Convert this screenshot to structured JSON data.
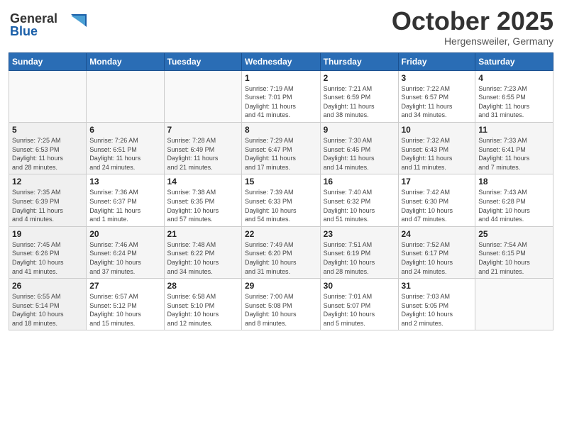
{
  "header": {
    "logo_general": "General",
    "logo_blue": "Blue",
    "month": "October 2025",
    "location": "Hergensweiler, Germany"
  },
  "weekdays": [
    "Sunday",
    "Monday",
    "Tuesday",
    "Wednesday",
    "Thursday",
    "Friday",
    "Saturday"
  ],
  "weeks": [
    [
      {
        "day": "",
        "info": ""
      },
      {
        "day": "",
        "info": ""
      },
      {
        "day": "",
        "info": ""
      },
      {
        "day": "1",
        "info": "Sunrise: 7:19 AM\nSunset: 7:01 PM\nDaylight: 11 hours\nand 41 minutes."
      },
      {
        "day": "2",
        "info": "Sunrise: 7:21 AM\nSunset: 6:59 PM\nDaylight: 11 hours\nand 38 minutes."
      },
      {
        "day": "3",
        "info": "Sunrise: 7:22 AM\nSunset: 6:57 PM\nDaylight: 11 hours\nand 34 minutes."
      },
      {
        "day": "4",
        "info": "Sunrise: 7:23 AM\nSunset: 6:55 PM\nDaylight: 11 hours\nand 31 minutes."
      }
    ],
    [
      {
        "day": "5",
        "info": "Sunrise: 7:25 AM\nSunset: 6:53 PM\nDaylight: 11 hours\nand 28 minutes."
      },
      {
        "day": "6",
        "info": "Sunrise: 7:26 AM\nSunset: 6:51 PM\nDaylight: 11 hours\nand 24 minutes."
      },
      {
        "day": "7",
        "info": "Sunrise: 7:28 AM\nSunset: 6:49 PM\nDaylight: 11 hours\nand 21 minutes."
      },
      {
        "day": "8",
        "info": "Sunrise: 7:29 AM\nSunset: 6:47 PM\nDaylight: 11 hours\nand 17 minutes."
      },
      {
        "day": "9",
        "info": "Sunrise: 7:30 AM\nSunset: 6:45 PM\nDaylight: 11 hours\nand 14 minutes."
      },
      {
        "day": "10",
        "info": "Sunrise: 7:32 AM\nSunset: 6:43 PM\nDaylight: 11 hours\nand 11 minutes."
      },
      {
        "day": "11",
        "info": "Sunrise: 7:33 AM\nSunset: 6:41 PM\nDaylight: 11 hours\nand 7 minutes."
      }
    ],
    [
      {
        "day": "12",
        "info": "Sunrise: 7:35 AM\nSunset: 6:39 PM\nDaylight: 11 hours\nand 4 minutes."
      },
      {
        "day": "13",
        "info": "Sunrise: 7:36 AM\nSunset: 6:37 PM\nDaylight: 11 hours\nand 1 minute."
      },
      {
        "day": "14",
        "info": "Sunrise: 7:38 AM\nSunset: 6:35 PM\nDaylight: 10 hours\nand 57 minutes."
      },
      {
        "day": "15",
        "info": "Sunrise: 7:39 AM\nSunset: 6:33 PM\nDaylight: 10 hours\nand 54 minutes."
      },
      {
        "day": "16",
        "info": "Sunrise: 7:40 AM\nSunset: 6:32 PM\nDaylight: 10 hours\nand 51 minutes."
      },
      {
        "day": "17",
        "info": "Sunrise: 7:42 AM\nSunset: 6:30 PM\nDaylight: 10 hours\nand 47 minutes."
      },
      {
        "day": "18",
        "info": "Sunrise: 7:43 AM\nSunset: 6:28 PM\nDaylight: 10 hours\nand 44 minutes."
      }
    ],
    [
      {
        "day": "19",
        "info": "Sunrise: 7:45 AM\nSunset: 6:26 PM\nDaylight: 10 hours\nand 41 minutes."
      },
      {
        "day": "20",
        "info": "Sunrise: 7:46 AM\nSunset: 6:24 PM\nDaylight: 10 hours\nand 37 minutes."
      },
      {
        "day": "21",
        "info": "Sunrise: 7:48 AM\nSunset: 6:22 PM\nDaylight: 10 hours\nand 34 minutes."
      },
      {
        "day": "22",
        "info": "Sunrise: 7:49 AM\nSunset: 6:20 PM\nDaylight: 10 hours\nand 31 minutes."
      },
      {
        "day": "23",
        "info": "Sunrise: 7:51 AM\nSunset: 6:19 PM\nDaylight: 10 hours\nand 28 minutes."
      },
      {
        "day": "24",
        "info": "Sunrise: 7:52 AM\nSunset: 6:17 PM\nDaylight: 10 hours\nand 24 minutes."
      },
      {
        "day": "25",
        "info": "Sunrise: 7:54 AM\nSunset: 6:15 PM\nDaylight: 10 hours\nand 21 minutes."
      }
    ],
    [
      {
        "day": "26",
        "info": "Sunrise: 6:55 AM\nSunset: 5:14 PM\nDaylight: 10 hours\nand 18 minutes."
      },
      {
        "day": "27",
        "info": "Sunrise: 6:57 AM\nSunset: 5:12 PM\nDaylight: 10 hours\nand 15 minutes."
      },
      {
        "day": "28",
        "info": "Sunrise: 6:58 AM\nSunset: 5:10 PM\nDaylight: 10 hours\nand 12 minutes."
      },
      {
        "day": "29",
        "info": "Sunrise: 7:00 AM\nSunset: 5:08 PM\nDaylight: 10 hours\nand 8 minutes."
      },
      {
        "day": "30",
        "info": "Sunrise: 7:01 AM\nSunset: 5:07 PM\nDaylight: 10 hours\nand 5 minutes."
      },
      {
        "day": "31",
        "info": "Sunrise: 7:03 AM\nSunset: 5:05 PM\nDaylight: 10 hours\nand 2 minutes."
      },
      {
        "day": "",
        "info": ""
      }
    ]
  ]
}
